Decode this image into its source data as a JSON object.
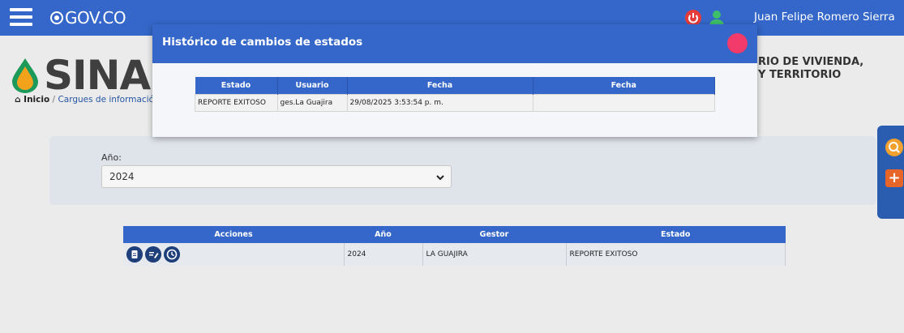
{
  "topbar": {
    "brand": "GOV.CO",
    "user_name": "Juan Felipe Romero Sierra",
    "icons": [
      "menu-icon",
      "power-icon",
      "user-icon"
    ]
  },
  "header": {
    "logo_text": "SINAS",
    "ministry_line1": "RIO DE VIVIENDA,",
    "ministry_line2": "Y TERRITORIO"
  },
  "breadcrumb": {
    "home": "Inicio",
    "separator": "/",
    "current": "Cargues de informació"
  },
  "filter": {
    "year_label": "Año:",
    "year_value": "2024"
  },
  "results": {
    "headers": [
      "Acciones",
      "Año",
      "Gestor",
      "Estado"
    ],
    "rows": [
      {
        "year": "2024",
        "gestor": "LA GUAJIRA",
        "estado": "REPORTE EXITOSO",
        "actions": [
          "document-icon",
          "edit-icon",
          "history-icon"
        ]
      }
    ]
  },
  "modal": {
    "title": "Histórico de cambios de estados",
    "headers": [
      "Estado",
      "Usuario",
      "Fecha",
      "Fecha"
    ],
    "rows": [
      {
        "estado": "REPORTE EXITOSO",
        "usuario": "ges.La Guajira",
        "fecha": "29/08/2025 3:53:54 p. m.",
        "fecha2": ""
      }
    ]
  },
  "colors": {
    "primary": "#3467c9",
    "close_button": "#f23a6b",
    "search_tool": "#f0a12e",
    "add_tool": "#e8652a"
  }
}
